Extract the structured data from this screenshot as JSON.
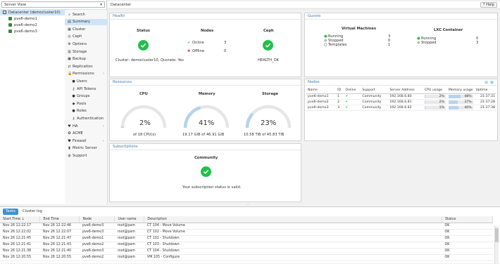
{
  "server_view": "Server View",
  "tree": {
    "datacenter": "Datacenter (democluster10)",
    "nodes": [
      "pve6-demo1",
      "pve6-demo2",
      "pve6-demo3"
    ]
  },
  "header": {
    "title": "Datacenter",
    "help": "Help"
  },
  "menu": [
    {
      "label": "Search",
      "icon": "search-icon",
      "glyph": "⌕"
    },
    {
      "label": "Summary",
      "icon": "book-icon",
      "glyph": "▤"
    },
    {
      "label": "Cluster",
      "icon": "server-icon",
      "glyph": "▦"
    },
    {
      "label": "Ceph",
      "icon": "ceph-icon",
      "glyph": "◎"
    },
    {
      "label": "Options",
      "icon": "gear-icon",
      "glyph": "⚙"
    },
    {
      "label": "Storage",
      "icon": "database-icon",
      "glyph": "▥"
    },
    {
      "label": "Backup",
      "icon": "floppy-icon",
      "glyph": "▣"
    },
    {
      "label": "Replication",
      "icon": "retweet-icon",
      "glyph": "⇄"
    },
    {
      "label": "Permissions",
      "icon": "unlock-icon",
      "glyph": "🔓"
    },
    {
      "label": "Users",
      "icon": "user-icon",
      "glyph": "●"
    },
    {
      "label": "API Tokens",
      "icon": "key-icon",
      "glyph": "⚷"
    },
    {
      "label": "Groups",
      "icon": "users-icon",
      "glyph": "●"
    },
    {
      "label": "Pools",
      "icon": "tags-icon",
      "glyph": "◆"
    },
    {
      "label": "Roles",
      "icon": "male-icon",
      "glyph": "●"
    },
    {
      "label": "Authentication",
      "icon": "key-icon",
      "glyph": "⚷"
    },
    {
      "label": "HA",
      "icon": "heartbeat-icon",
      "glyph": "♥"
    },
    {
      "label": "ACME",
      "icon": "certificate-icon",
      "glyph": "✪"
    },
    {
      "label": "Firewall",
      "icon": "shield-icon",
      "glyph": "⛊"
    },
    {
      "label": "Metric Server",
      "icon": "bar-chart-icon",
      "glyph": "▮"
    },
    {
      "label": "Support",
      "icon": "support-icon",
      "glyph": "◍"
    }
  ],
  "health": {
    "title": "Health",
    "status_label": "Status",
    "nodes_label": "Nodes",
    "ceph_label": "Ceph",
    "online_label": "Online",
    "online": "3",
    "offline_label": "Offline",
    "offline": "0",
    "cluster_text": "Cluster: democluster10, Quorate: Yes",
    "ceph_status": "HEALTH_OK"
  },
  "guests": {
    "title": "Guests",
    "vm_title": "Virtual Machines",
    "lxc_title": "LXC Container",
    "vm": [
      {
        "label": "Running",
        "value": "3"
      },
      {
        "label": "Stopped",
        "value": "0"
      },
      {
        "label": "Templates",
        "value": "1"
      }
    ],
    "lxc": [
      {
        "label": "Running",
        "value": "0"
      },
      {
        "label": "Stopped",
        "value": "3"
      }
    ]
  },
  "resources": {
    "title": "Resources",
    "cpu": {
      "label": "CPU",
      "value": "2%",
      "pct": 2,
      "sub": "of 18 CPU(s)"
    },
    "memory": {
      "label": "Memory",
      "value": "41%",
      "pct": 41,
      "sub": "19.17 GiB of 46.91 GiB"
    },
    "storage": {
      "label": "Storage",
      "value": "23%",
      "pct": 23,
      "sub": "10.58 TiB of 45.83 TiB"
    }
  },
  "nodes": {
    "title": "Nodes",
    "columns": [
      "Name",
      "ID",
      "Online",
      "Support",
      "Server Address",
      "CPU usage",
      "Memory usage",
      "Uptime"
    ],
    "rows": [
      {
        "name": "pve6-demo1",
        "id": "1",
        "support": "Community",
        "addr": "192.168.6.80",
        "cpu": "2%",
        "cpu_pct": 2,
        "mem": "48%",
        "mem_pct": 48,
        "uptime": "21:37:31"
      },
      {
        "name": "pve6-demo2",
        "id": "2",
        "support": "Community",
        "addr": "192.168.6.81",
        "cpu": "2%",
        "cpu_pct": 2,
        "mem": "37%",
        "mem_pct": 37,
        "uptime": "21:37:28"
      },
      {
        "name": "pve6-demo3",
        "id": "3",
        "support": "Community",
        "addr": "192.168.6.82",
        "cpu": "1%",
        "cpu_pct": 1,
        "mem": "40%",
        "mem_pct": 40,
        "uptime": "21:37:38"
      }
    ]
  },
  "subscriptions": {
    "title": "Subscriptions",
    "type": "Community",
    "message": "Your subscription status is valid."
  },
  "bottom": {
    "tabs": [
      "Tasks",
      "Cluster log"
    ],
    "columns": [
      "Start Time ↓",
      "End Time",
      "Node",
      "User name",
      "Description",
      "Status"
    ],
    "rows": [
      [
        "Nov 26 12:22:17",
        "Nov 26 12:22:46",
        "pve6-demo3",
        "root@pam",
        "CT 104 - Move Volume",
        "OK"
      ],
      [
        "Nov 26 12:22:02",
        "Nov 26 12:22:07",
        "pve6-demo3",
        "root@pam",
        "CT 102 - Move Volume",
        "OK"
      ],
      [
        "Nov 26 12:21:45",
        "Nov 26 12:21:47",
        "pve6-demo1",
        "root@pam",
        "CT 102 - Shutdown",
        "OK"
      ],
      [
        "Nov 26 12:21:41",
        "Nov 26 12:21:43",
        "pve6-demo2",
        "root@pam",
        "CT 103 - Shutdown",
        "OK"
      ],
      [
        "Nov 26 12:21:38",
        "Nov 26 12:21:40",
        "pve6-demo3",
        "root@pam",
        "CT 104 - Shutdown",
        "OK"
      ],
      [
        "Nov 26 12:20:55",
        "Nov 26 12:20:55",
        "pve6-demo2",
        "root@pam",
        "VM 105 - Configure",
        "OK"
      ]
    ]
  }
}
